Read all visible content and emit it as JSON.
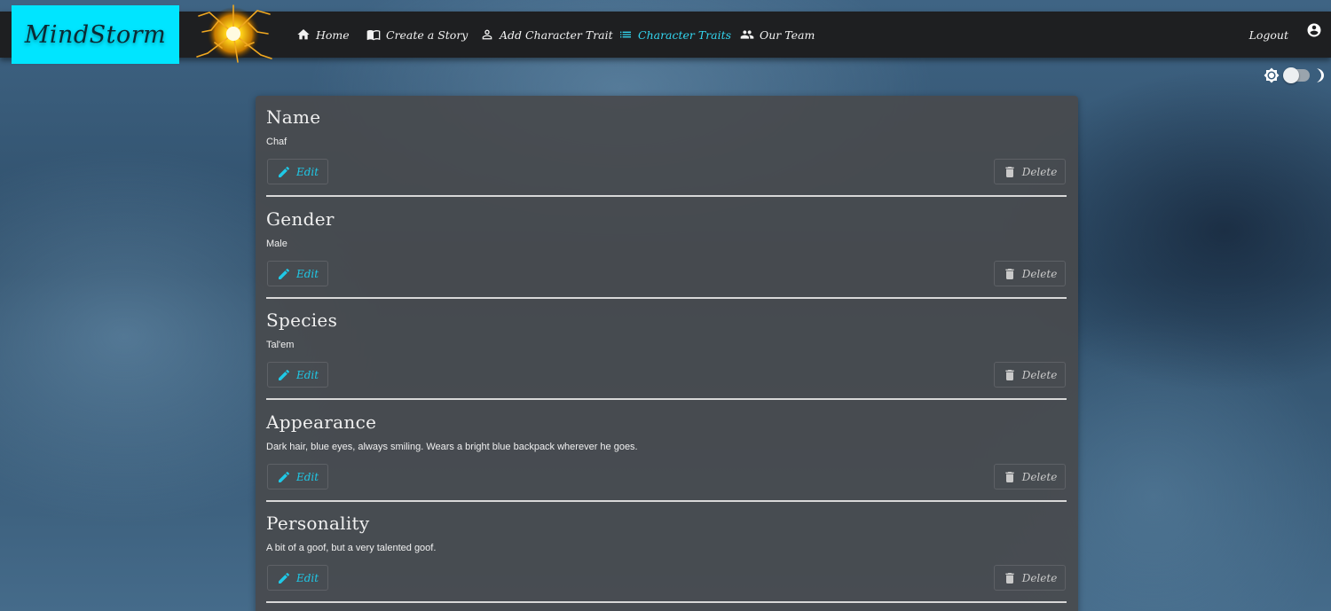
{
  "brand": {
    "name": "MindStorm"
  },
  "nav": {
    "items": [
      {
        "label": "Home",
        "icon": "home-icon",
        "active": false
      },
      {
        "label": "Create a Story",
        "icon": "book-icon",
        "active": false
      },
      {
        "label": "Add Character Trait",
        "icon": "person-icon",
        "active": false
      },
      {
        "label": "Character Traits",
        "icon": "list-icon",
        "active": true
      },
      {
        "label": "Our Team",
        "icon": "group-icon",
        "active": false
      }
    ],
    "logout_label": "Logout"
  },
  "theme": {
    "mode": "dark"
  },
  "colors": {
    "accent": "#00e5ff",
    "link": "#1fc8e6",
    "navbar": "#1e1f21",
    "card": "#484a4e"
  },
  "buttons": {
    "edit_label": "Edit",
    "delete_label": "Delete"
  },
  "traits": [
    {
      "title": "Name",
      "value": "Chaf"
    },
    {
      "title": "Gender",
      "value": "Male"
    },
    {
      "title": "Species",
      "value": "Tal'em"
    },
    {
      "title": "Appearance",
      "value": "Dark hair, blue eyes, always smiling. Wears a bright blue backpack wherever he goes."
    },
    {
      "title": "Personality",
      "value": "A bit of a goof, but a very talented goof."
    }
  ]
}
